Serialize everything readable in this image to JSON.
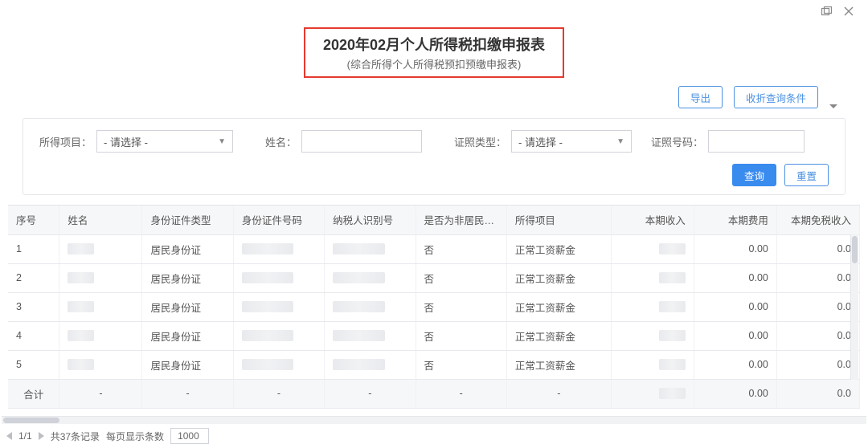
{
  "window_controls": {
    "maximize": "maximize",
    "close": "close"
  },
  "header": {
    "title": "2020年02月个人所得税扣缴申报表",
    "subtitle": "(综合所得个人所得税预扣预缴申报表)"
  },
  "actions": {
    "export_label": "导出",
    "collapse_label": "收折查询条件"
  },
  "filters": {
    "income_item_label": "所得项目：",
    "income_item_value": "- 请选择 -",
    "name_label": "姓名：",
    "name_value": "",
    "id_type_label": "证照类型：",
    "id_type_value": "- 请选择 -",
    "id_no_label": "证照号码：",
    "id_no_value": "",
    "query_label": "查询",
    "reset_label": "重置"
  },
  "table": {
    "headers": {
      "seq": "序号",
      "name": "姓名",
      "id_type": "身份证件类型",
      "id_no": "身份证件号码",
      "tax_id": "纳税人识别号",
      "non_resident": "是否为非居民个人",
      "income_item": "所得项目",
      "income": "本期收入",
      "fee": "本期费用",
      "exempt": "本期免税收入"
    },
    "rows": [
      {
        "seq": "1",
        "id_type": "居民身份证",
        "non_resident": "否",
        "income_item": "正常工资薪金",
        "fee": "0.00",
        "exempt": "0.0"
      },
      {
        "seq": "2",
        "id_type": "居民身份证",
        "non_resident": "否",
        "income_item": "正常工资薪金",
        "fee": "0.00",
        "exempt": "0.0"
      },
      {
        "seq": "3",
        "id_type": "居民身份证",
        "non_resident": "否",
        "income_item": "正常工资薪金",
        "fee": "0.00",
        "exempt": "0.0"
      },
      {
        "seq": "4",
        "id_type": "居民身份证",
        "non_resident": "否",
        "income_item": "正常工资薪金",
        "fee": "0.00",
        "exempt": "0.0"
      },
      {
        "seq": "5",
        "id_type": "居民身份证",
        "non_resident": "否",
        "income_item": "正常工资薪金",
        "fee": "0.00",
        "exempt": "0.0"
      }
    ],
    "footer": {
      "label": "合计",
      "name": "-",
      "id_type": "-",
      "id_no": "-",
      "tax_id": "-",
      "non_resident": "-",
      "income_item": "-",
      "fee": "0.00",
      "exempt": "0.0"
    }
  },
  "pager": {
    "page": "1/1",
    "total": "共37条记录",
    "pagesize_label": "每页显示条数",
    "pagesize_value": "1000"
  }
}
